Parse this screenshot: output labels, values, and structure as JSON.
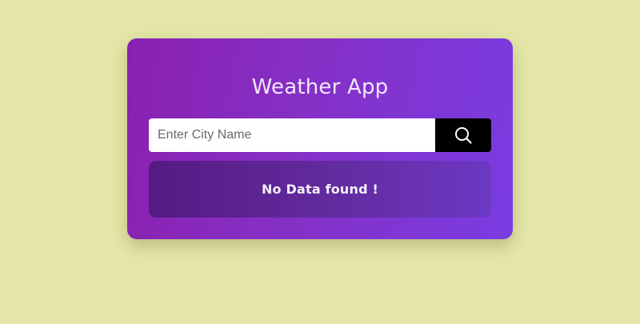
{
  "app": {
    "title": "Weather App"
  },
  "search": {
    "value": "",
    "placeholder": "Enter City Name",
    "button_icon": "search-icon"
  },
  "result": {
    "message": "No Data found !"
  },
  "colors": {
    "page_background": "#e3e6a6",
    "card_gradient_start": "#8a20b0",
    "card_gradient_end": "#7a3ce2",
    "search_button": "#000000",
    "result_box": "#561a82"
  }
}
